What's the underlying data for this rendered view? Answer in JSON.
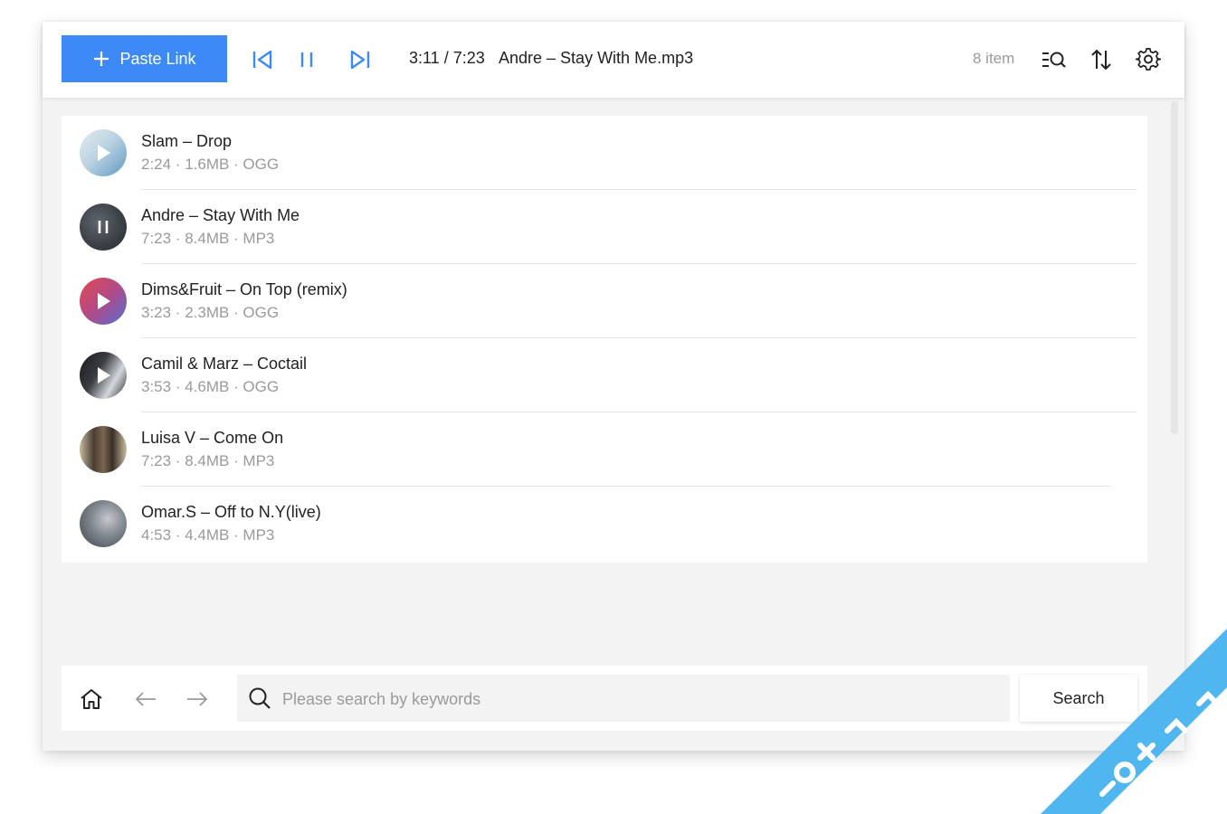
{
  "toolbar": {
    "paste_label": "Paste Link",
    "icons": [
      "previous-track-icon",
      "pause-icon",
      "next-track-icon",
      "queue-icon",
      "sort-icon",
      "settings-icon"
    ],
    "now_playing": {
      "time": "3:11 / 7:23",
      "title": "Andre – Stay With Me.mp3"
    },
    "item_count": "8 item"
  },
  "tracks": [
    {
      "title": "Slam – Drop",
      "meta": "2:24 · 1.6MB · OGG",
      "state": "play",
      "thumb_colors": [
        "#d7e3ea",
        "#6aa0c4"
      ]
    },
    {
      "title": "Andre – Stay With Me",
      "meta": "7:23 · 8.4MB · MP3",
      "state": "pause",
      "thumb_colors": [
        "#3b4148",
        "#5a6268"
      ]
    },
    {
      "title": "Dims&Fruit – On Top (remix)",
      "meta": "3:23 · 2.3MB · OGG",
      "state": "play",
      "thumb_colors": [
        "#d0485a",
        "#5b6fd0"
      ]
    },
    {
      "title": "Camil & Marz – Coctail",
      "meta": "3:53 · 4.6MB · OGG",
      "state": "play",
      "thumb_colors": [
        "#202226",
        "#c9cdd2"
      ]
    },
    {
      "title": "Luisa V – Come On",
      "meta": "7:23 · 8.4MB · MP3",
      "state": "none",
      "thumb_colors": [
        "#3a3128",
        "#c2b39c"
      ]
    },
    {
      "title": "Omar.S – Off to N.Y(live)",
      "meta": "4:53 · 4.4MB · MP3",
      "state": "none",
      "thumb_colors": [
        "#4a5058",
        "#b3b9bf"
      ]
    }
  ],
  "bottom": {
    "icons": [
      "home-icon",
      "back-arrow-icon",
      "forward-arrow-icon",
      "search-icon"
    ],
    "search_placeholder": "Please search by keywords",
    "search_value": "",
    "search_button": "Search"
  },
  "colors": {
    "accent": "#3d8af7",
    "watermark": "#4fb6f0"
  }
}
